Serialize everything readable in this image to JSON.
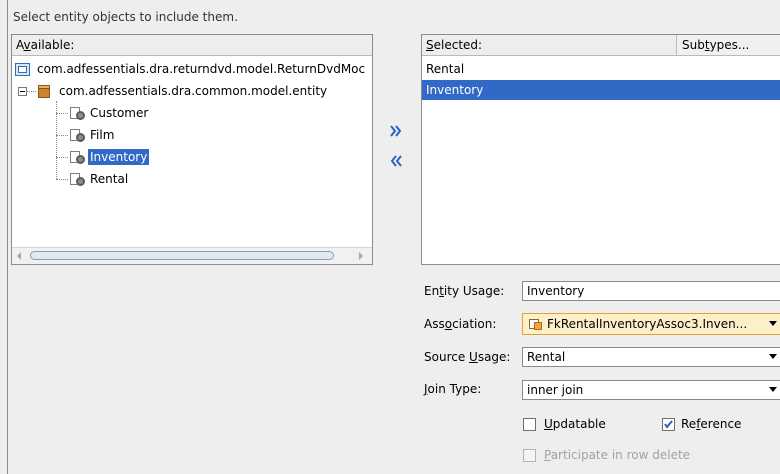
{
  "instruction": "Select entity objects to include them.",
  "available": {
    "label_pre": "A",
    "label_mnemonic": "v",
    "label_post": "ailable:",
    "root": "com.adfessentials.dra.returndvd.model.ReturnDvdMoc",
    "package": "com.adfessentials.dra.common.model.entity",
    "entities": [
      "Customer",
      "Film",
      "Inventory",
      "Rental"
    ]
  },
  "transfer": {
    "add_icon": "double-chevron-right",
    "remove_icon": "double-chevron-left"
  },
  "selected": {
    "label_mnemonic": "S",
    "label_post": "elected:",
    "subtypes_pre": "Sub",
    "subtypes_mnemonic": "t",
    "subtypes_post": "ypes...",
    "items": [
      "Rental",
      "Inventory"
    ]
  },
  "form": {
    "entity_usage": {
      "label_pre": "En",
      "label_mnemonic": "t",
      "label_post": "ity Usage:",
      "value": "Inventory"
    },
    "association": {
      "label_pre": "Ass",
      "label_mnemonic": "o",
      "label_post": "ciation:",
      "value": "FkRentalInventoryAssoc3.Inven..."
    },
    "source_usage": {
      "label_pre": "Source ",
      "label_mnemonic": "U",
      "label_post": "sage:",
      "value": "Rental"
    },
    "join_type": {
      "label_mnemonic": "J",
      "label_post": "oin Type:",
      "value": "inner join"
    },
    "updatable": {
      "label_mnemonic": "U",
      "label_post": "pdatable",
      "checked": false
    },
    "reference": {
      "label_pre": "Re",
      "label_mnemonic": "f",
      "label_post": "erence",
      "checked": true
    },
    "participate": {
      "label_mnemonic": "P",
      "label_post": "articipate in row delete",
      "checked": false,
      "enabled": false
    }
  },
  "colors": {
    "selection": "#3169c6",
    "association_bg": "#fdf0c8"
  }
}
